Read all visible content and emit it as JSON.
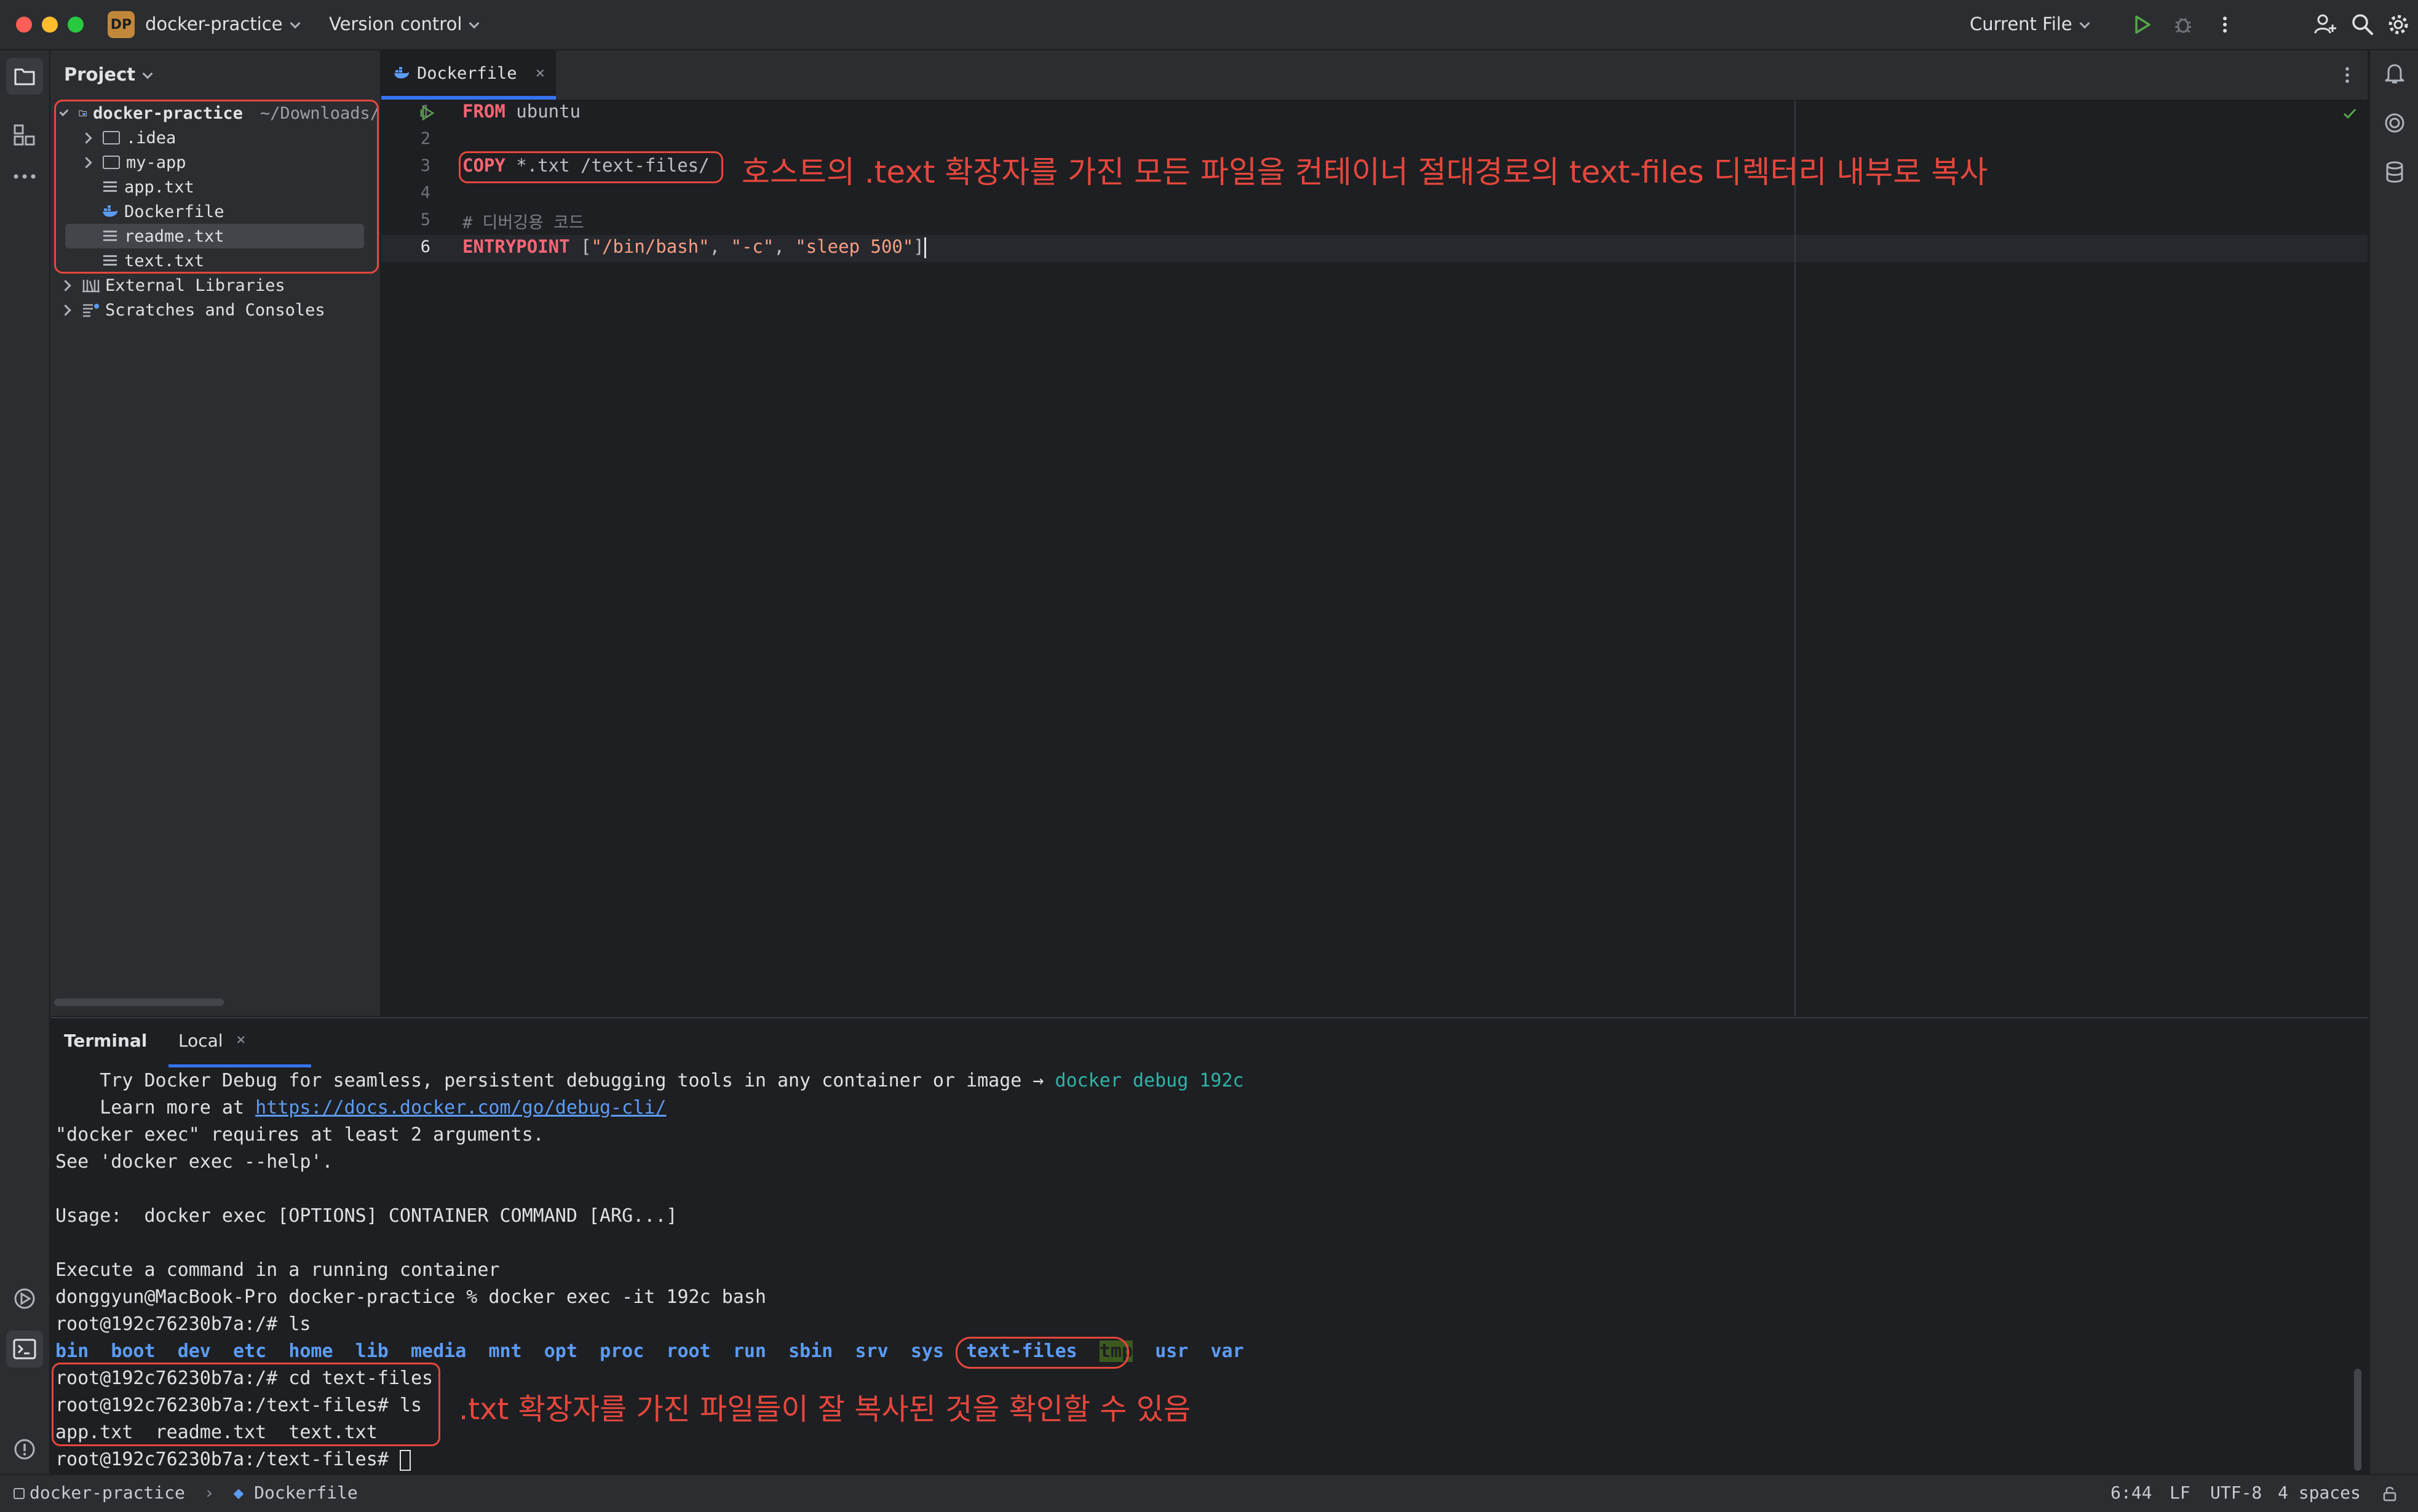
{
  "titlebar": {
    "project_badge": "DP",
    "project_name": "docker-practice",
    "vcs": "Version control",
    "run_config": "Current File"
  },
  "project_panel": {
    "title": "Project",
    "root": {
      "name": "docker-practice",
      "path": "~/Downloads/"
    },
    "items": [
      {
        "name": ".idea",
        "type": "folder"
      },
      {
        "name": "my-app",
        "type": "folder"
      },
      {
        "name": "app.txt",
        "type": "file"
      },
      {
        "name": "Dockerfile",
        "type": "docker"
      },
      {
        "name": "readme.txt",
        "type": "file",
        "selected": true
      },
      {
        "name": "text.txt",
        "type": "file"
      }
    ],
    "external_libraries": "External Libraries",
    "scratches": "Scratches and Consoles"
  },
  "editor": {
    "tab": "Dockerfile",
    "line_numbers": [
      "1",
      "2",
      "3",
      "4",
      "5",
      "6"
    ],
    "lines": {
      "l1_kw": "FROM",
      "l1_rest": " ubuntu",
      "l3_kw": "COPY",
      "l3_rest": " *.txt /text-files/",
      "l5_comment": "# 디버깅용 코드",
      "l6_kw": "ENTRYPOINT",
      "l6_open": " [",
      "l6_s1": "\"/bin/bash\"",
      "l6_sep1": ", ",
      "l6_s2": "\"-c\"",
      "l6_sep2": ", ",
      "l6_s3": "\"sleep 500\"",
      "l6_close": "]"
    },
    "annotation": "호스트의 .text 확장자를 가진 모든 파일을 컨테이너 절대경로의 text-files 디렉터리 내부로 복사"
  },
  "terminal": {
    "title": "Terminal",
    "tab": "Local",
    "lines": {
      "t1_a": "    Try Docker Debug for seamless, persistent debugging tools in any container or image → ",
      "t1_b": "docker debug 192c",
      "t2_a": "    Learn more at ",
      "t2_link": "https://docs.docker.com/go/debug-cli/",
      "t3": "\"docker exec\" requires at least 2 arguments.",
      "t4": "See 'docker exec --help'.",
      "t6": "Usage:  docker exec [OPTIONS] CONTAINER COMMAND [ARG...]",
      "t8": "Execute a command in a running container",
      "t9": "donggyun@MacBook-Pro docker-practice % docker exec -it 192c bash",
      "t10": "root@192c76230b7a:/# ls",
      "t12": "root@192c76230b7a:/# cd text-files",
      "t13": "root@192c76230b7a:/text-files# ls",
      "t14": "app.txt  readme.txt  text.txt",
      "t15": "root@192c76230b7a:/text-files# "
    },
    "ls_dirs": [
      "bin",
      "boot",
      "dev",
      "etc",
      "home",
      "lib",
      "media",
      "mnt",
      "opt",
      "proc",
      "root",
      "run",
      "sbin",
      "srv",
      "sys",
      "text-files",
      "tmp",
      "usr",
      "var"
    ],
    "annotation": ".txt 확장자를 가진 파일들이 잘 복사된 것을 확인할 수 있음"
  },
  "statusbar": {
    "crumb_project": "docker-practice",
    "crumb_file": "Dockerfile",
    "position": "6:44",
    "line_sep": "LF",
    "encoding": "UTF-8",
    "indent": "4 spaces"
  },
  "colors": {
    "accent": "#3574f0",
    "annotation_red": "#e6473d",
    "keyword": "#fa6675",
    "string": "#fa9f85"
  }
}
